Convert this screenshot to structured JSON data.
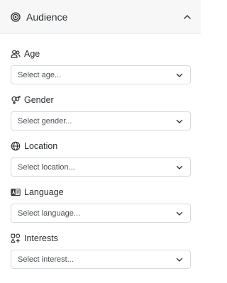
{
  "header": {
    "title": "Audience",
    "icon": "target-icon",
    "toggle_icon": "chevron-up-icon"
  },
  "fields": [
    {
      "label": "Age",
      "icon": "users-icon",
      "placeholder": "Select age..."
    },
    {
      "label": "Gender",
      "icon": "gender-icon",
      "placeholder": "Select gender..."
    },
    {
      "label": "Location",
      "icon": "globe-icon",
      "placeholder": "Select location..."
    },
    {
      "label": "Language",
      "icon": "language-icon",
      "placeholder": "Select language..."
    },
    {
      "label": "Interests",
      "icon": "interests-icon",
      "placeholder": "Select interest..."
    }
  ]
}
